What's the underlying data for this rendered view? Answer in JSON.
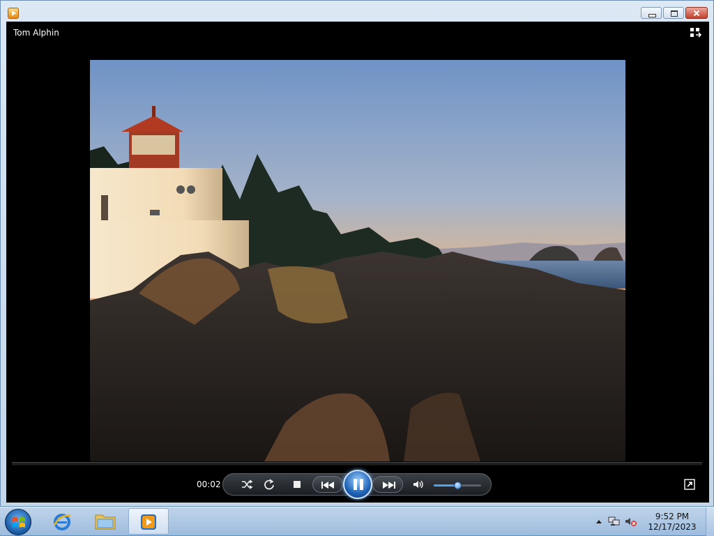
{
  "window": {
    "app_icon": "media-player-icon",
    "caption_buttons": [
      "minimize-icon",
      "restore-icon",
      "close-icon"
    ]
  },
  "player": {
    "media_title": "Tom Alphin",
    "switch_library_icon": "switch-to-library-icon",
    "elapsed_time": "00:02",
    "seek_progress": 0.0,
    "volume_level": 0.5,
    "accent_color": "#4fa2ee",
    "controls": [
      "shuffle-icon",
      "repeat-icon",
      "stop-icon",
      "previous-icon",
      "pause-icon",
      "next-icon",
      "volume-icon"
    ],
    "fullscreen_icon": "fullscreen-icon",
    "photo": "lighthouse-on-rocky-coast-at-sunset"
  },
  "taskbar": {
    "start_icon": "windows-start-icon",
    "pinned": [
      "internet-explorer-icon",
      "file-explorer-icon",
      "media-player-icon"
    ],
    "active_item": "media-player-icon",
    "tray_icons": [
      "show-hidden-icons-icon",
      "network-icon",
      "volume-muted-icon"
    ],
    "time": "9:52 PM",
    "date": "12/17/2023"
  }
}
